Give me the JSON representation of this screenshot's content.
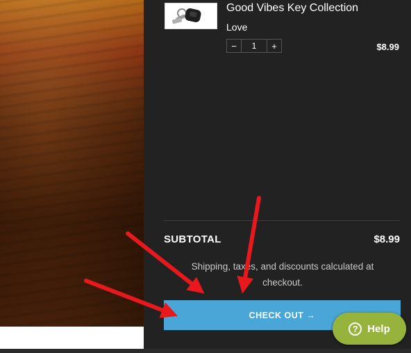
{
  "cart": {
    "item": {
      "title": "Good Vibes Key Collection",
      "variant": "Love",
      "quantity": "1",
      "price": "$8.99",
      "minus": "−",
      "plus": "+"
    },
    "subtotal_label": "SUBTOTAL",
    "subtotal_value": "$8.99",
    "note": "Shipping, taxes, and discounts calculated at checkout.",
    "checkout_label": "CHECK OUT →"
  },
  "help": {
    "label": "Help",
    "icon_glyph": "?"
  },
  "colors": {
    "drawer_bg": "#222222",
    "checkout_blue": "#4aa6d6",
    "help_green": "#96b43c",
    "annotation_red": "#e8191c"
  },
  "icons": [
    "key-product-thumbnail",
    "help-question-icon",
    "annotation-arrow"
  ]
}
